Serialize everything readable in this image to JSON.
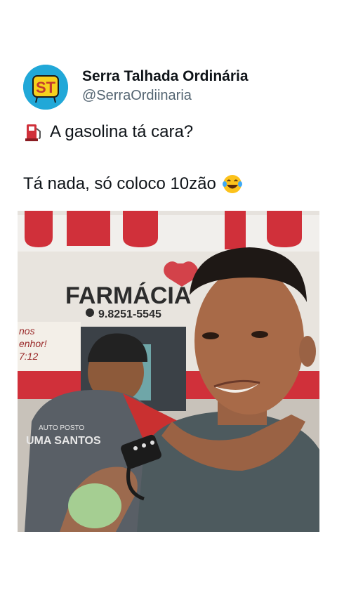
{
  "author": {
    "display_name": "Serra Talhada Ordinária",
    "handle": "@SerraOrdiinaria",
    "avatar_text": "ST"
  },
  "tweet": {
    "line1": "A gasolina tá cara?",
    "line2": "Tá nada, só coloco 10zão",
    "line1_emoji": "fuel-pump-icon",
    "line2_emoji": "laughing-tears-emoji"
  },
  "media": {
    "sign_text": "FARMÁCIA",
    "phone_text": "9.8251-5545",
    "shirt_text_top": "AUTO POSTO",
    "shirt_text_bottom": "UMA SANTOS",
    "price_sign": "nos\nenhor!\n7:12"
  },
  "colors": {
    "accent_red": "#d0303a",
    "avatar_bg": "#21a8d8",
    "handle_gray": "#536471"
  }
}
